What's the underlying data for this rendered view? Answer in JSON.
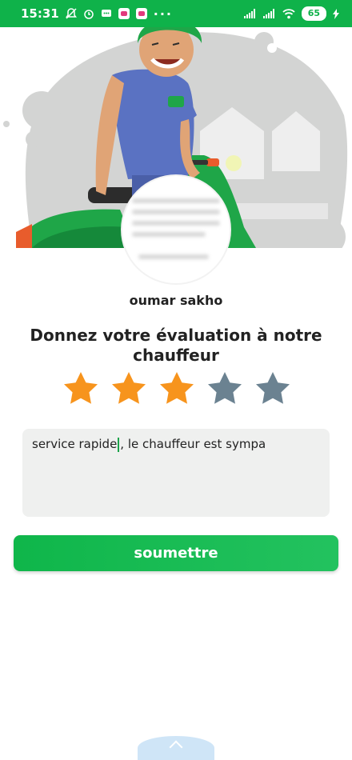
{
  "status_bar": {
    "time": "15:31",
    "dots": "···",
    "battery": "65"
  },
  "driver": {
    "name": "oumar sakho"
  },
  "rating": {
    "prompt": "Donnez votre évaluation à notre chauffeur",
    "value": 3,
    "max": 5,
    "active_color": "#f7941d",
    "inactive_color": "#6b8291"
  },
  "comment": {
    "text_before_cursor": "service rapide",
    "text_after_cursor": ", le chauffeur est sympa"
  },
  "submit": {
    "label": "soumettre",
    "color": "#12b44c"
  },
  "colors": {
    "status_bar": "#0fb24a",
    "input_bg": "#eff0ef",
    "handle": "#cfe5f7"
  }
}
